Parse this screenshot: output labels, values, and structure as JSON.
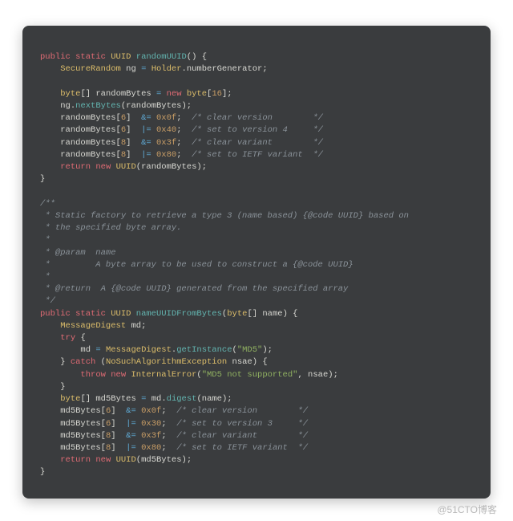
{
  "watermark": "@51CTO博客",
  "code": {
    "m1": {
      "sig_kw1": "public",
      "sig_kw2": "static",
      "sig_type": "UUID",
      "sig_name": "randomUUID",
      "l1_type": "SecureRandom",
      "l1_var": "ng",
      "l1_cls": "Holder",
      "l1_fld": "numberGenerator",
      "l2_type": "byte",
      "l2_var": "randomBytes",
      "l2_kw": "new",
      "l2_t2": "byte",
      "l2_n": "16",
      "l3_obj": "ng",
      "l3_fn": "nextBytes",
      "l3_arg": "randomBytes",
      "l4_a": "randomBytes",
      "l4_i": "6",
      "l4_op": "&=",
      "l4_v": "0x0f",
      "l4_c": "/* clear version        */",
      "l5_a": "randomBytes",
      "l5_i": "6",
      "l5_op": "|=",
      "l5_v": "0x40",
      "l5_c": "/* set to version 4     */",
      "l6_a": "randomBytes",
      "l6_i": "8",
      "l6_op": "&=",
      "l6_v": "0x3f",
      "l6_c": "/* clear variant        */",
      "l7_a": "randomBytes",
      "l7_i": "8",
      "l7_op": "|=",
      "l7_v": "0x80",
      "l7_c": "/* set to IETF variant  */",
      "l8_kw1": "return",
      "l8_kw2": "new",
      "l8_t": "UUID",
      "l8_arg": "randomBytes"
    },
    "doc": {
      "l1": "/**",
      "l2": " * Static factory to retrieve a type 3 (name based) {@code UUID} based on",
      "l3": " * the specified byte array.",
      "l4": " *",
      "l5": " * @param  name",
      "l6": " *         A byte array to be used to construct a {@code UUID}",
      "l7": " *",
      "l8": " * @return  A {@code UUID} generated from the specified array",
      "l9": " */"
    },
    "m2": {
      "sig_kw1": "public",
      "sig_kw2": "static",
      "sig_type": "UUID",
      "sig_name": "nameUUIDFromBytes",
      "sig_pt": "byte",
      "sig_pn": "name",
      "l1_t": "MessageDigest",
      "l1_v": "md",
      "l2_kw": "try",
      "l3_v": "md",
      "l3_cls": "MessageDigest",
      "l3_fn": "getInstance",
      "l3_s": "\"MD5\"",
      "l4_kw": "catch",
      "l4_t": "NoSuchAlgorithmException",
      "l4_v": "nsae",
      "l5_kw1": "throw",
      "l5_kw2": "new",
      "l5_t": "InternalError",
      "l5_s": "\"MD5 not supported\"",
      "l5_a": "nsae",
      "l6_t": "byte",
      "l6_v": "md5Bytes",
      "l6_o": "md",
      "l6_fn": "digest",
      "l6_a": "name",
      "l7_a": "md5Bytes",
      "l7_i": "6",
      "l7_op": "&=",
      "l7_v": "0x0f",
      "l7_c": "/* clear version        */",
      "l8_a": "md5Bytes",
      "l8_i": "6",
      "l8_op": "|=",
      "l8_v": "0x30",
      "l8_c": "/* set to version 3     */",
      "l9_a": "md5Bytes",
      "l9_i": "8",
      "l9_op": "&=",
      "l9_v": "0x3f",
      "l9_c": "/* clear variant        */",
      "l10_a": "md5Bytes",
      "l10_i": "8",
      "l10_op": "|=",
      "l10_v": "0x80",
      "l10_c": "/* set to IETF variant  */",
      "l11_kw1": "return",
      "l11_kw2": "new",
      "l11_t": "UUID",
      "l11_a": "md5Bytes"
    }
  }
}
